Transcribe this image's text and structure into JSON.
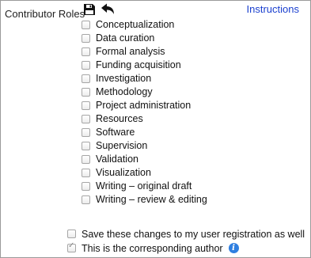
{
  "header": {
    "title": "Contributor Roles",
    "instructions_link": "Instructions",
    "save_icon": "floppy-disk-icon",
    "undo_icon": "undo-arrow-icon"
  },
  "roles": [
    {
      "label": "Conceptualization",
      "checked": false
    },
    {
      "label": "Data curation",
      "checked": false
    },
    {
      "label": "Formal analysis",
      "checked": false
    },
    {
      "label": "Funding acquisition",
      "checked": false
    },
    {
      "label": "Investigation",
      "checked": false
    },
    {
      "label": "Methodology",
      "checked": false
    },
    {
      "label": "Project administration",
      "checked": false
    },
    {
      "label": "Resources",
      "checked": false
    },
    {
      "label": "Software",
      "checked": false
    },
    {
      "label": "Supervision",
      "checked": false
    },
    {
      "label": "Validation",
      "checked": false
    },
    {
      "label": "Visualization",
      "checked": false
    },
    {
      "label": "Writing – original draft",
      "checked": false
    },
    {
      "label": "Writing – review & editing",
      "checked": false
    }
  ],
  "options": {
    "save_registration": {
      "label": "Save these changes to my user registration as well",
      "checked": false
    },
    "corresponding_author": {
      "label": "This is the corresponding author",
      "checked": true
    }
  },
  "colors": {
    "link": "#1a3fcf",
    "info": "#2f7fe0"
  }
}
